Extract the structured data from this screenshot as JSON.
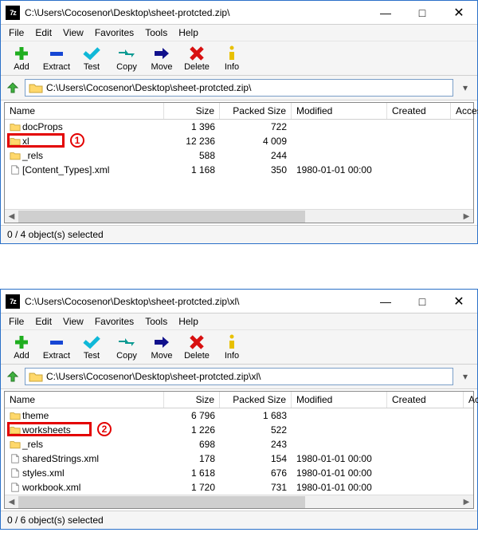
{
  "window1": {
    "title": "C:\\Users\\Cocosenor\\Desktop\\sheet-protcted.zip\\",
    "path": "C:\\Users\\Cocosenor\\Desktop\\sheet-protcted.zip\\",
    "status": "0 / 4 object(s) selected",
    "callout": "1",
    "rows": [
      {
        "name": "docProps",
        "type": "folder",
        "size": "1 396",
        "packed": "722",
        "modified": "",
        "highlight": false
      },
      {
        "name": "xl",
        "type": "folder",
        "size": "12 236",
        "packed": "4 009",
        "modified": "",
        "highlight": true
      },
      {
        "name": "_rels",
        "type": "folder",
        "size": "588",
        "packed": "244",
        "modified": "",
        "highlight": false
      },
      {
        "name": "[Content_Types].xml",
        "type": "file",
        "size": "1 168",
        "packed": "350",
        "modified": "1980-01-01 00:00",
        "highlight": false
      }
    ]
  },
  "window2": {
    "title": "C:\\Users\\Cocosenor\\Desktop\\sheet-protcted.zip\\xl\\",
    "path": "C:\\Users\\Cocosenor\\Desktop\\sheet-protcted.zip\\xl\\",
    "status": "0 / 6 object(s) selected",
    "callout": "2",
    "rows": [
      {
        "name": "theme",
        "type": "folder",
        "size": "6 796",
        "packed": "1 683",
        "modified": "",
        "highlight": false
      },
      {
        "name": "worksheets",
        "type": "folder",
        "size": "1 226",
        "packed": "522",
        "modified": "",
        "highlight": true
      },
      {
        "name": "_rels",
        "type": "folder",
        "size": "698",
        "packed": "243",
        "modified": "",
        "highlight": false
      },
      {
        "name": "sharedStrings.xml",
        "type": "file",
        "size": "178",
        "packed": "154",
        "modified": "1980-01-01 00:00",
        "highlight": false
      },
      {
        "name": "styles.xml",
        "type": "file",
        "size": "1 618",
        "packed": "676",
        "modified": "1980-01-01 00:00",
        "highlight": false
      },
      {
        "name": "workbook.xml",
        "type": "file",
        "size": "1 720",
        "packed": "731",
        "modified": "1980-01-01 00:00",
        "highlight": false
      }
    ]
  },
  "menu": {
    "file": "File",
    "edit": "Edit",
    "view": "View",
    "favorites": "Favorites",
    "tools": "Tools",
    "help": "Help"
  },
  "toolbar": {
    "add": "Add",
    "extract": "Extract",
    "test": "Test",
    "copy": "Copy",
    "move": "Move",
    "delete": "Delete",
    "info": "Info"
  },
  "columns": {
    "name": "Name",
    "size": "Size",
    "packed": "Packed Size",
    "modified": "Modified",
    "created": "Created",
    "accessed1": "Acces",
    "accessed2": "Ac"
  },
  "app_icon_label": "7z"
}
